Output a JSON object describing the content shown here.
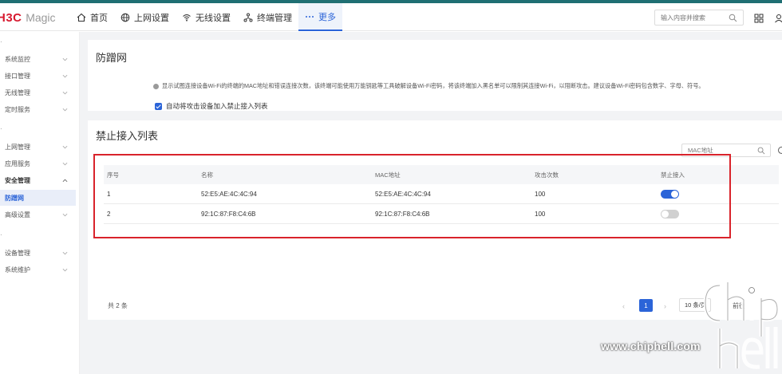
{
  "header": {
    "logo_brand": "H3C",
    "logo_product": "Magic",
    "nav": [
      {
        "label": "首页",
        "icon": "home-icon"
      },
      {
        "label": "上网设置",
        "icon": "globe-icon"
      },
      {
        "label": "无线设置",
        "icon": "wifi-icon"
      },
      {
        "label": "终端管理",
        "icon": "devices-icon"
      },
      {
        "label": "更多",
        "icon": "more-icon",
        "active": true
      }
    ],
    "search_placeholder": "输入内容并搜索"
  },
  "sidebar": {
    "groups": [
      "",
      "",
      ""
    ],
    "items": [
      {
        "label": "系统监控"
      },
      {
        "label": "接口管理"
      },
      {
        "label": "无线管理"
      },
      {
        "label": "定时服务"
      },
      {
        "label": "上网管理"
      },
      {
        "label": "应用服务"
      },
      {
        "label": "安全管理",
        "expanded": true
      },
      {
        "label": "防蹭网",
        "active": true
      },
      {
        "label": "高级设置"
      },
      {
        "label": "设备管理"
      },
      {
        "label": "系统维护"
      }
    ]
  },
  "anti_leech": {
    "title": "防蹭网",
    "description": "显示试图连接设备Wi-Fi的终端的MAC地址和错误连接次数，该终端可能使用万能钥匙等工具破解设备Wi-Fi密码，将该终端加入黑名单可以限制其连接Wi-Fi，以阻断攻击。建议设备Wi-Fi密码包含数字、字母、符号。",
    "auto_block_label": "自动将攻击设备加入禁止接入列表",
    "auto_block_checked": true
  },
  "block_list": {
    "title": "禁止接入列表",
    "mac_search_placeholder": "MAC地址",
    "columns": [
      "序号",
      "名称",
      "MAC地址",
      "攻击次数",
      "禁止接入"
    ],
    "rows": [
      {
        "index": "1",
        "name": "52:E5:AE:4C:4C:94",
        "mac": "52:E5:AE:4C:4C:94",
        "attacks": "100",
        "blocked": true
      },
      {
        "index": "2",
        "name": "92:1C:87:F8:C4:6B",
        "mac": "92:1C:87:F8:C4:6B",
        "attacks": "100",
        "blocked": false
      }
    ],
    "total": "共 2 条",
    "current_page": "1",
    "page_size": "10 条/页",
    "goto_label": "前往"
  },
  "watermark": {
    "site": "www.chiphell.com",
    "logo_text": "chip hell"
  },
  "colors": {
    "accent": "#2b64d8",
    "brand_red": "#d7192f",
    "highlight_border": "#d9232b",
    "top_strip": "#1f6f73"
  }
}
